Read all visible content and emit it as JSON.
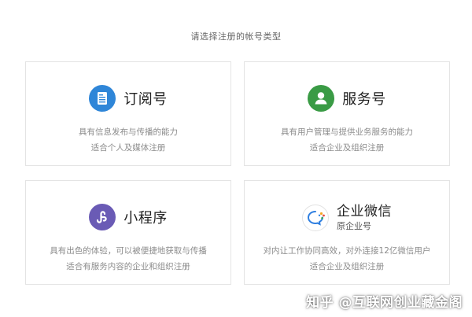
{
  "heading": "请选择注册的帐号类型",
  "cards": [
    {
      "title": "订阅号",
      "icon": "document-icon",
      "icon_color": "#2f86d8",
      "desc": [
        "具有信息发布与传播的能力",
        "适合个人及媒体注册"
      ]
    },
    {
      "title": "服务号",
      "icon": "user-icon",
      "icon_color": "#3a9b45",
      "desc": [
        "具有用户管理与提供业务服务的能力",
        "适合企业及组织注册"
      ]
    },
    {
      "title": "小程序",
      "icon": "mini-program-icon",
      "icon_color": "#6a5bb5",
      "desc": [
        "具有出色的体验，可以被便捷地获取与传播",
        "适合有服务内容的企业和组织注册"
      ]
    },
    {
      "title": "企业微信",
      "subtitle": "原企业号",
      "icon": "wework-icon",
      "desc": [
        "对内让工作协同高效，对外连接12亿微信用户",
        "适合企业及组织注册"
      ]
    }
  ],
  "watermark": "知乎 @互联网创业藏金阁"
}
